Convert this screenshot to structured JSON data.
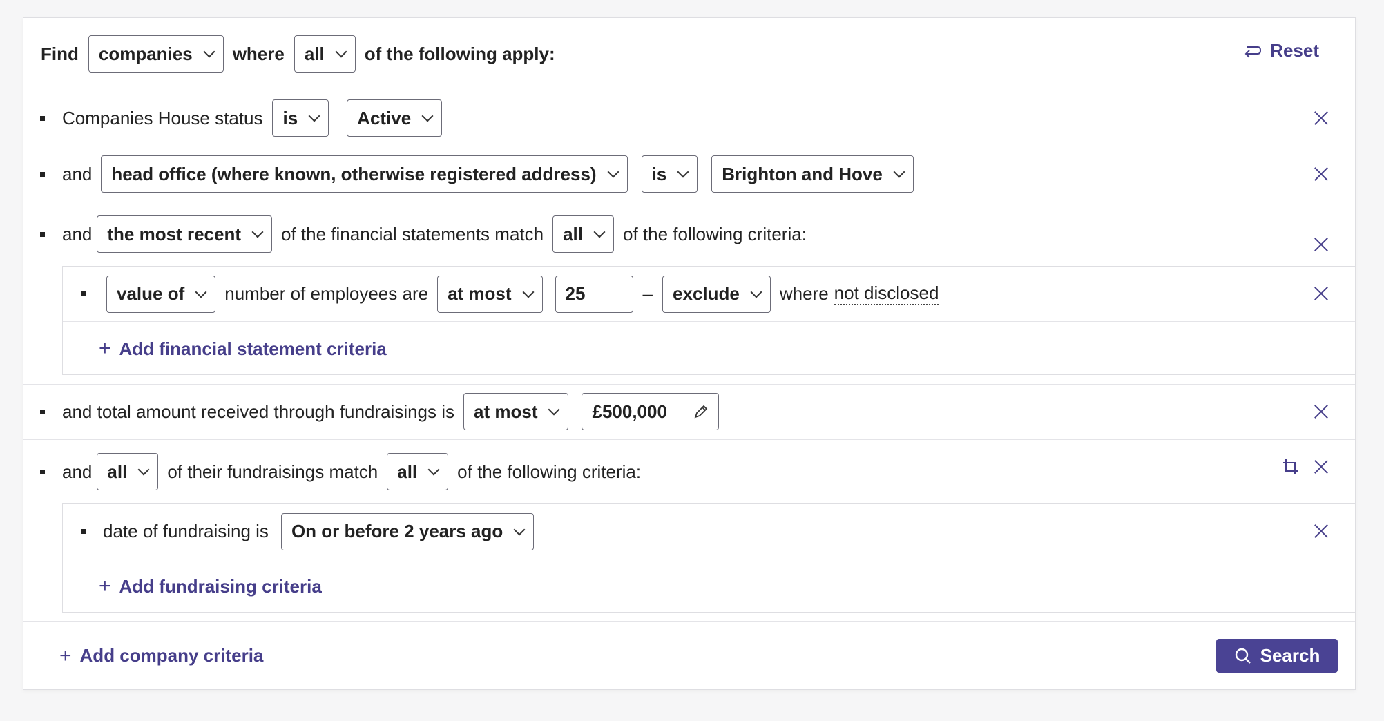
{
  "header": {
    "find_label": "Find",
    "entity_select": "companies",
    "where_label": "where",
    "match_select": "all",
    "apply_label": "of the following apply:",
    "reset_label": "Reset"
  },
  "criteria": {
    "status": {
      "label": "Companies House status",
      "op": "is",
      "value": "Active"
    },
    "office": {
      "and": "and",
      "field": "head office (where known, otherwise registered address)",
      "op": "is",
      "value": "Brighton and Hove"
    },
    "financial": {
      "and": "and",
      "which": "the most recent",
      "mid": "of the financial statements match",
      "match": "all",
      "tail": "of the following criteria:",
      "sub": {
        "valueof": "value of",
        "field": "number of employees are",
        "op": "at most",
        "amount": "25",
        "dash": "–",
        "exclude": "exclude",
        "where": "where",
        "undisclosed": "not disclosed"
      },
      "add_label": "Add financial statement criteria"
    },
    "fundraising_total": {
      "label": "and total amount received through fundraisings is",
      "op": "at most",
      "value": "£500,000"
    },
    "fundraisings": {
      "and": "and",
      "which": "all",
      "mid": "of their fundraisings match",
      "match": "all",
      "tail": "of the following criteria:",
      "sub": {
        "label": "date of fundraising is",
        "value": "On or before 2 years ago"
      },
      "add_label": "Add fundraising criteria"
    }
  },
  "footer": {
    "add_company_label": "Add company criteria",
    "search_label": "Search"
  },
  "colors": {
    "accent": "#463e8a",
    "button_bg": "#4a4394"
  }
}
